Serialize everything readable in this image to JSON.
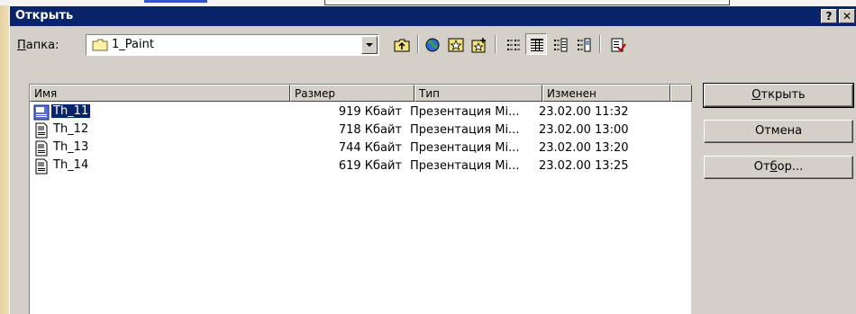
{
  "dialog": {
    "title": "Открыть",
    "help_label": "?",
    "close_label": "✕"
  },
  "folder": {
    "label_mnemonic": "П",
    "label_rest": "апка:",
    "value": "1_Paint"
  },
  "columns": {
    "name": "Имя",
    "size": "Размер",
    "type": "Тип",
    "modified": "Изменен"
  },
  "files": [
    {
      "name": "Th_11",
      "size": "919 Кбайт",
      "type": "Презентация Mi...",
      "modified": "23.02.00 11:32",
      "selected": true
    },
    {
      "name": "Th_12",
      "size": "718 Кбайт",
      "type": "Презентация Mi...",
      "modified": "23.02.00 13:00",
      "selected": false
    },
    {
      "name": "Th_13",
      "size": "744 Кбайт",
      "type": "Презентация Mi...",
      "modified": "23.02.00 13:20",
      "selected": false
    },
    {
      "name": "Th_14",
      "size": "619 Кбайт",
      "type": "Презентация Mi...",
      "modified": "23.02.00 13:25",
      "selected": false
    }
  ],
  "buttons": {
    "open_mnemonic": "О",
    "open_rest": "ткрыть",
    "cancel": "Отмена",
    "filter_pre": "От",
    "filter_mnemonic": "б",
    "filter_post": "ор..."
  },
  "toolbar_icons": [
    "up-folder-icon",
    "search-web-icon",
    "favorites-icon",
    "add-to-favorites-icon",
    "list-view-icon",
    "details-view-icon",
    "properties-view-icon",
    "preview-view-icon",
    "commands-icon"
  ],
  "colors": {
    "titlebar": "#0a246a",
    "face": "#d4d0c8",
    "selection": "#0a246a"
  }
}
